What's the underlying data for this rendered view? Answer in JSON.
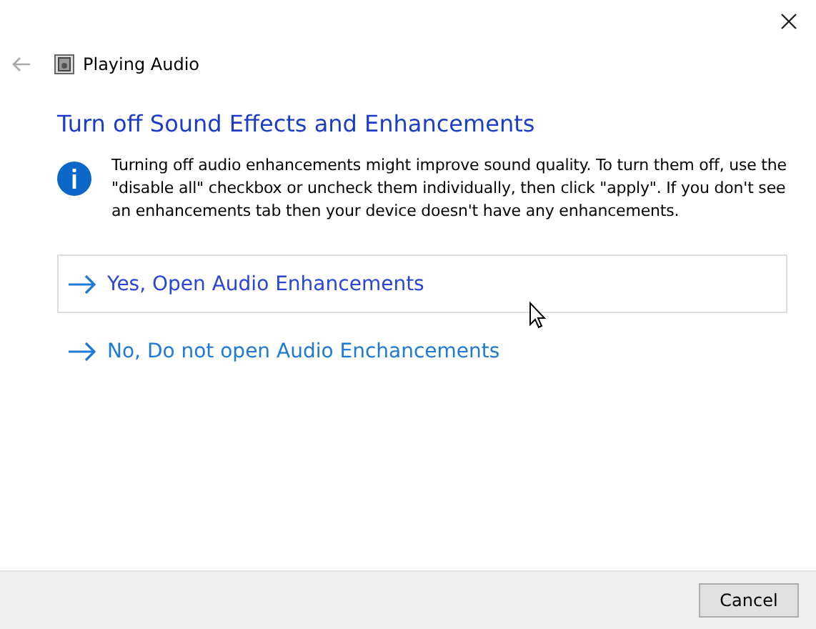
{
  "window": {
    "title": "Playing Audio"
  },
  "heading": "Turn off Sound Effects and Enhancements",
  "message": "Turning off audio enhancements might improve sound quality. To turn them off, use the \"disable all\" checkbox or uncheck them individually, then click \"apply\". If you don't see an enhancements tab then your device doesn't have any enhancements.",
  "options": [
    {
      "label": "Yes, Open Audio Enhancements",
      "hovered": true
    },
    {
      "label": "No, Do not open Audio Enchancements",
      "hovered": false
    }
  ],
  "buttons": [
    "Cancel"
  ]
}
